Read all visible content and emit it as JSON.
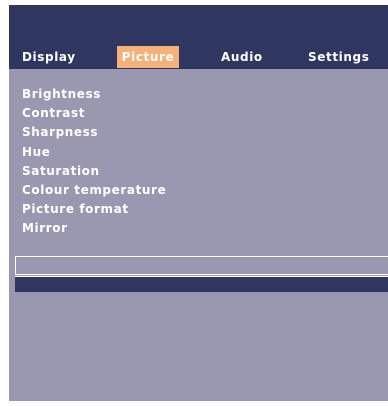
{
  "tabs": [
    {
      "label": "Display",
      "active": false
    },
    {
      "label": "Picture",
      "active": true
    },
    {
      "label": "Audio",
      "active": false
    },
    {
      "label": "Settings",
      "active": false
    }
  ],
  "menu_items": [
    "Brightness",
    "Contrast",
    "Sharpness",
    "Hue",
    "Saturation",
    "Colour temperature",
    "Picture format",
    "Mirror"
  ],
  "colors": {
    "background": "#9a97b1",
    "header": "#2f3761",
    "active_tab": "#f4b27a",
    "text": "#ffffff"
  }
}
